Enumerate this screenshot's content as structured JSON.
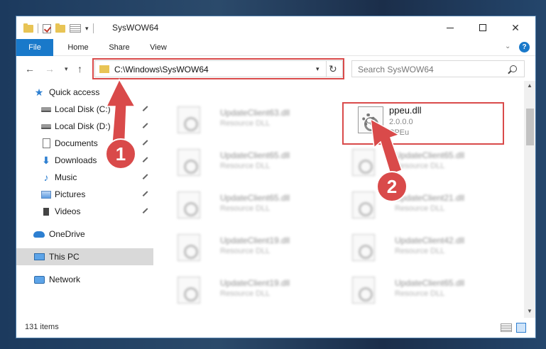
{
  "window": {
    "title": "SysWOW64",
    "controls": {
      "minimize": "–",
      "maximize": "□",
      "close": "✕"
    }
  },
  "ribbon": {
    "tabs": [
      "File",
      "Home",
      "Share",
      "View"
    ],
    "help": "?"
  },
  "address": {
    "path": "C:\\Windows\\SysWOW64",
    "search_placeholder": "Search SysWOW64"
  },
  "sidebar": {
    "items": [
      {
        "label": "Quick access",
        "icon": "star-icon"
      },
      {
        "label": "Local Disk (C:)",
        "icon": "disk-icon",
        "pinned": true
      },
      {
        "label": "Local Disk (D:)",
        "icon": "disk-icon",
        "pinned": true
      },
      {
        "label": "Documents",
        "icon": "document-icon",
        "pinned": true
      },
      {
        "label": "Downloads",
        "icon": "download-icon",
        "pinned": true
      },
      {
        "label": "Music",
        "icon": "music-icon",
        "pinned": true
      },
      {
        "label": "Pictures",
        "icon": "picture-icon",
        "pinned": true
      },
      {
        "label": "Videos",
        "icon": "video-icon",
        "pinned": true
      },
      {
        "label": "OneDrive",
        "icon": "cloud-icon"
      },
      {
        "label": "This PC",
        "icon": "computer-icon",
        "selected": true
      },
      {
        "label": "Network",
        "icon": "network-icon"
      }
    ]
  },
  "files": {
    "left_column": [
      {
        "name": "UpdateClient63.dll",
        "type": "Resource DLL"
      },
      {
        "name": "UpdateClient65.dll",
        "type": "Resource DLL"
      },
      {
        "name": "UpdateClient65.dll",
        "type": "Resource DLL"
      },
      {
        "name": "UpdateClient19.dll",
        "type": "Resource DLL"
      },
      {
        "name": "UpdateClient19.dll",
        "type": "Resource DLL"
      }
    ],
    "right_column": [
      {
        "name": "UpdateClient65.dll",
        "type": "Resource DLL"
      },
      {
        "name": "UpdateClient21.dll",
        "type": "Resource DLL"
      },
      {
        "name": "UpdateClient42.dll",
        "type": "Resource DLL"
      },
      {
        "name": "UpdateClient65.dll",
        "type": "Resource DLL"
      }
    ],
    "highlighted": {
      "name": "ppeu.dll",
      "version": "2.0.0.0",
      "description": "PPEu"
    }
  },
  "status": {
    "item_count": "131 items"
  },
  "annotations": {
    "step1": "1",
    "step2": "2",
    "color": "#d94a4a"
  }
}
